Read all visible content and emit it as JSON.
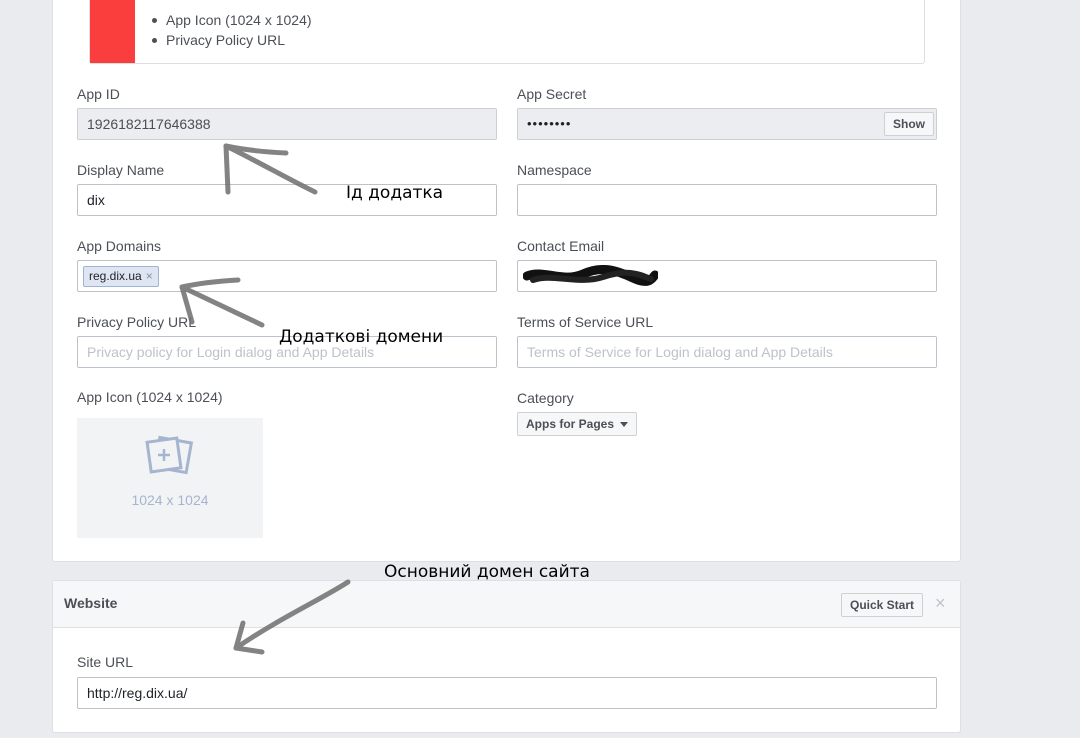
{
  "requirements": {
    "items": [
      "App Icon (1024 x 1024)",
      "Privacy Policy URL"
    ],
    "alert_color": "#fa3e3e"
  },
  "basic": {
    "app_id": {
      "label": "App ID",
      "value": "1926182117646388"
    },
    "app_secret": {
      "label": "App Secret",
      "masked_value": "••••••••",
      "show_label": "Show"
    },
    "display_name": {
      "label": "Display Name",
      "value": "dix"
    },
    "namespace": {
      "label": "Namespace",
      "value": ""
    },
    "app_domains": {
      "label": "App Domains",
      "tokens": [
        "reg.dix.ua"
      ],
      "remove_icon": "×"
    },
    "contact_email": {
      "label": "Contact Email",
      "value_note": "obscured"
    },
    "privacy_policy": {
      "label": "Privacy Policy URL",
      "placeholder": "Privacy policy for Login dialog and App Details"
    },
    "terms_of_service": {
      "label": "Terms of Service URL",
      "placeholder": "Terms of Service for Login dialog and App Details"
    },
    "app_icon": {
      "label": "App Icon (1024 x 1024)",
      "size_text": "1024 x 1024",
      "icon": "add-photo-icon"
    },
    "category": {
      "label": "Category",
      "value": "Apps for Pages",
      "icon": "chevron-down-icon"
    }
  },
  "website": {
    "title": "Website",
    "quick_start_label": "Quick Start",
    "close_label": "×",
    "site_url": {
      "label": "Site URL",
      "value": "http://reg.dix.ua/"
    }
  },
  "annotations": {
    "app_id_note": "Ід додатка",
    "domains_note": "Додаткові домени",
    "site_note": "Основний домен сайта"
  },
  "colors": {
    "page_bg": "#e9ebee",
    "readonly_bg": "#ebedf0",
    "token_bg": "#dfe6f2",
    "icon_placeholder": "#a5b5cf"
  }
}
